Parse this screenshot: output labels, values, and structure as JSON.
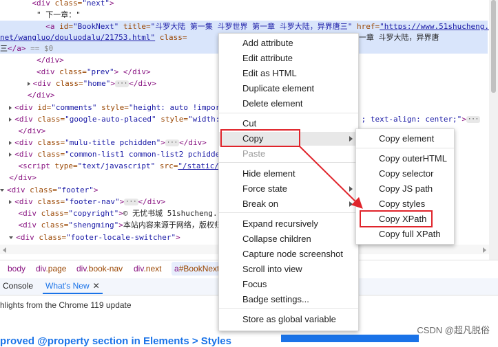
{
  "code_lines": [
    {
      "indent": "       ",
      "parts": [
        {
          "c": "t",
          "v": "<div "
        },
        {
          "c": "a",
          "v": "class="
        },
        {
          "c": "v",
          "v": "\"next\""
        },
        {
          "c": "t",
          "v": ">"
        }
      ]
    },
    {
      "indent": "        ",
      "parts": [
        {
          "c": "tx",
          "v": "\" 下一章：\""
        }
      ]
    },
    {
      "indent": "          ",
      "parts": [
        {
          "c": "t",
          "v": "<a "
        },
        {
          "c": "a",
          "v": "id="
        },
        {
          "c": "v",
          "v": "\"BookNext\" "
        },
        {
          "c": "a",
          "v": "title="
        },
        {
          "c": "v",
          "v": "\"斗罗大陆 第一集 斗罗世界 第一章 斗罗大陆，异界唐三\" "
        },
        {
          "c": "a",
          "v": "href="
        },
        {
          "c": "lnk",
          "v": "\"https://www.51shucheng."
        }
      ]
    },
    {
      "indent": "",
      "parts": [
        {
          "c": "lnk",
          "v": "net/wangluo/douluodalu/21753.html\""
        },
        {
          "c": "v",
          "v": " "
        },
        {
          "c": "a",
          "v": "class="
        },
        {
          "c": "tx",
          "v": "                              罗世界 第一章 斗罗大陆，异界唐"
        }
      ]
    },
    {
      "indent": "",
      "parts": [
        {
          "c": "tx",
          "v": "三"
        },
        {
          "c": "t",
          "v": "</a>"
        },
        {
          "c": "g",
          "v": " == $0"
        }
      ]
    },
    {
      "indent": "        ",
      "parts": [
        {
          "c": "t",
          "v": "</div>"
        }
      ]
    },
    {
      "indent": "        ",
      "parts": [
        {
          "c": "t",
          "v": "<div "
        },
        {
          "c": "a",
          "v": "class="
        },
        {
          "c": "v",
          "v": "\"prev\""
        },
        {
          "c": "t",
          "v": "> </div>"
        }
      ]
    },
    {
      "indent": "      ",
      "tri": "r",
      "parts": [
        {
          "c": "t",
          "v": "<div "
        },
        {
          "c": "a",
          "v": "class="
        },
        {
          "c": "v",
          "v": "\"home\""
        },
        {
          "c": "t",
          "v": ">"
        },
        {
          "c": "ell",
          "v": "···"
        },
        {
          "c": "t",
          "v": "</div>"
        }
      ]
    },
    {
      "indent": "      ",
      "parts": [
        {
          "c": "t",
          "v": "</div>"
        }
      ]
    },
    {
      "indent": "  ",
      "tri": "r",
      "parts": [
        {
          "c": "t",
          "v": "<div "
        },
        {
          "c": "a",
          "v": "id="
        },
        {
          "c": "v",
          "v": "\"comments\" "
        },
        {
          "c": "a",
          "v": "style="
        },
        {
          "c": "v",
          "v": "\"height: auto !import"
        }
      ]
    },
    {
      "indent": "  ",
      "tri": "r",
      "parts": [
        {
          "c": "t",
          "v": "<div "
        },
        {
          "c": "a",
          "v": "class="
        },
        {
          "c": "v",
          "v": "\"google-auto-placed\" "
        },
        {
          "c": "a",
          "v": "style="
        },
        {
          "c": "v",
          "v": "\"width:                               ; text-align: center;\""
        },
        {
          "c": "t",
          "v": ">"
        },
        {
          "c": "ell",
          "v": "···"
        }
      ]
    },
    {
      "indent": "    ",
      "parts": [
        {
          "c": "t",
          "v": "</div>"
        }
      ]
    },
    {
      "indent": "  ",
      "tri": "r",
      "parts": [
        {
          "c": "t",
          "v": "<div "
        },
        {
          "c": "a",
          "v": "class="
        },
        {
          "c": "v",
          "v": "\"mulu-title pchidden\""
        },
        {
          "c": "t",
          "v": ">"
        },
        {
          "c": "ell",
          "v": "···"
        },
        {
          "c": "t",
          "v": "</div>"
        }
      ]
    },
    {
      "indent": "  ",
      "tri": "r",
      "parts": [
        {
          "c": "t",
          "v": "<div "
        },
        {
          "c": "a",
          "v": "class="
        },
        {
          "c": "v",
          "v": "\"common-list1 common-list2 pchidder"
        }
      ]
    },
    {
      "indent": "    ",
      "parts": [
        {
          "c": "t",
          "v": "<script "
        },
        {
          "c": "a",
          "v": "type="
        },
        {
          "c": "v",
          "v": "\"text/javascript\" "
        },
        {
          "c": "a",
          "v": "src="
        },
        {
          "c": "lnk",
          "v": "\"/static/re"
        }
      ]
    },
    {
      "indent": "  ",
      "parts": [
        {
          "c": "t",
          "v": "</div>"
        }
      ]
    },
    {
      "indent": "",
      "tri": "d",
      "parts": [
        {
          "c": "t",
          "v": "<div "
        },
        {
          "c": "a",
          "v": "class="
        },
        {
          "c": "v",
          "v": "\"footer\""
        },
        {
          "c": "t",
          "v": ">"
        }
      ]
    },
    {
      "indent": "  ",
      "tri": "r",
      "parts": [
        {
          "c": "t",
          "v": "<div "
        },
        {
          "c": "a",
          "v": "class="
        },
        {
          "c": "v",
          "v": "\"footer-nav\""
        },
        {
          "c": "t",
          "v": ">"
        },
        {
          "c": "ell",
          "v": "···"
        },
        {
          "c": "t",
          "v": "</div>"
        }
      ]
    },
    {
      "indent": "    ",
      "parts": [
        {
          "c": "t",
          "v": "<div "
        },
        {
          "c": "a",
          "v": "class="
        },
        {
          "c": "v",
          "v": "\"copyright\""
        },
        {
          "c": "t",
          "v": ">"
        },
        {
          "c": "tx",
          "v": "© 无忧书城 51shucheng."
        }
      ]
    },
    {
      "indent": "    ",
      "parts": [
        {
          "c": "t",
          "v": "<div "
        },
        {
          "c": "a",
          "v": "class="
        },
        {
          "c": "v",
          "v": "\"shengming\""
        },
        {
          "c": "t",
          "v": ">"
        },
        {
          "c": "tx",
          "v": "本站内容来源于网络，版权归"
        }
      ]
    },
    {
      "indent": "  ",
      "tri": "d",
      "parts": [
        {
          "c": "t",
          "v": "<div "
        },
        {
          "c": "a",
          "v": "class="
        },
        {
          "c": "v",
          "v": "\"footer-locale-switcher\""
        },
        {
          "c": "t",
          "v": ">"
        }
      ]
    }
  ],
  "breadcrumbs": [
    {
      "tag": "body",
      "cls": ""
    },
    {
      "tag": "div",
      "cls": ".page"
    },
    {
      "tag": "div",
      "cls": ".book-nav"
    },
    {
      "tag": "div",
      "cls": ".next"
    },
    {
      "tag": "a",
      "cls": "#BookNext.a"
    }
  ],
  "drawer": {
    "tabs": {
      "console": "Console",
      "whats_new": "What's New",
      "close": "✕"
    },
    "line": "hlights from the Chrome 119 update",
    "heading": "proved @property section in Elements > Styles"
  },
  "context_menu": {
    "items": [
      {
        "label": "Add attribute"
      },
      {
        "label": "Edit attribute"
      },
      {
        "label": "Edit as HTML"
      },
      {
        "label": "Duplicate element"
      },
      {
        "label": "Delete element"
      },
      {
        "label": "Cut"
      },
      {
        "label": "Copy",
        "submenu": true
      },
      {
        "label": "Paste",
        "disabled": true
      },
      {
        "label": "Hide element"
      },
      {
        "label": "Force state",
        "submenu": true
      },
      {
        "label": "Break on",
        "submenu": true
      },
      {
        "label": "Expand recursively"
      },
      {
        "label": "Collapse children"
      },
      {
        "label": "Capture node screenshot"
      },
      {
        "label": "Scroll into view"
      },
      {
        "label": "Focus"
      },
      {
        "label": "Badge settings..."
      },
      {
        "label": "Store as global variable"
      }
    ]
  },
  "copy_submenu": {
    "items": [
      {
        "label": "Copy element"
      },
      {
        "label": "Copy outerHTML"
      },
      {
        "label": "Copy selector"
      },
      {
        "label": "Copy JS path"
      },
      {
        "label": "Copy styles"
      },
      {
        "label": "Copy XPath"
      },
      {
        "label": "Copy full XPath"
      }
    ]
  },
  "watermark": "CSDN @超凡脱俗",
  "colors": {
    "highlight_box": "#e0242b",
    "selection": "#d9e5fb",
    "accent": "#1a73e8"
  }
}
